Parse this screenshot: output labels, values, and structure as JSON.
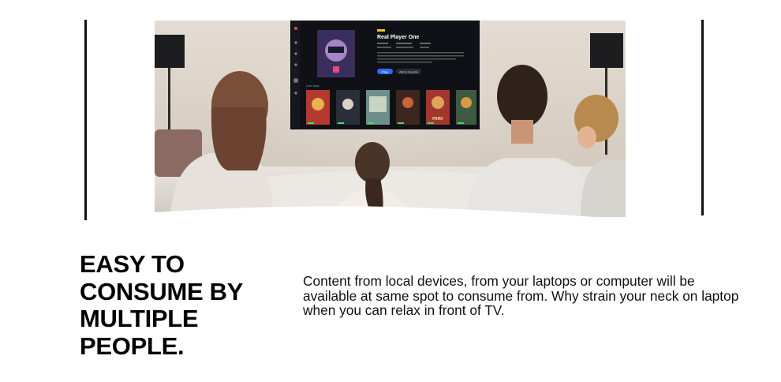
{
  "section": {
    "heading": "EASY TO CONSUME BY MULTIPLE PEOPLE.",
    "description": "Content from local devices, from your laptops or computer will be available at same spot to consume from. Why strain your neck on laptop when you can relax in front of TV."
  },
  "tv_screen": {
    "movie_title": "Real Player One",
    "play_label": "Play",
    "favorite_label": "Add to Favorite",
    "row_title": "Live Now",
    "poster_caption": "PARK"
  },
  "colors": {
    "accent": "#2f6df6",
    "badge": "#f2c230",
    "tv_background": "#111319",
    "wall": "#dcd3c8"
  },
  "icons": [
    "lamp-icon",
    "play-icon"
  ]
}
